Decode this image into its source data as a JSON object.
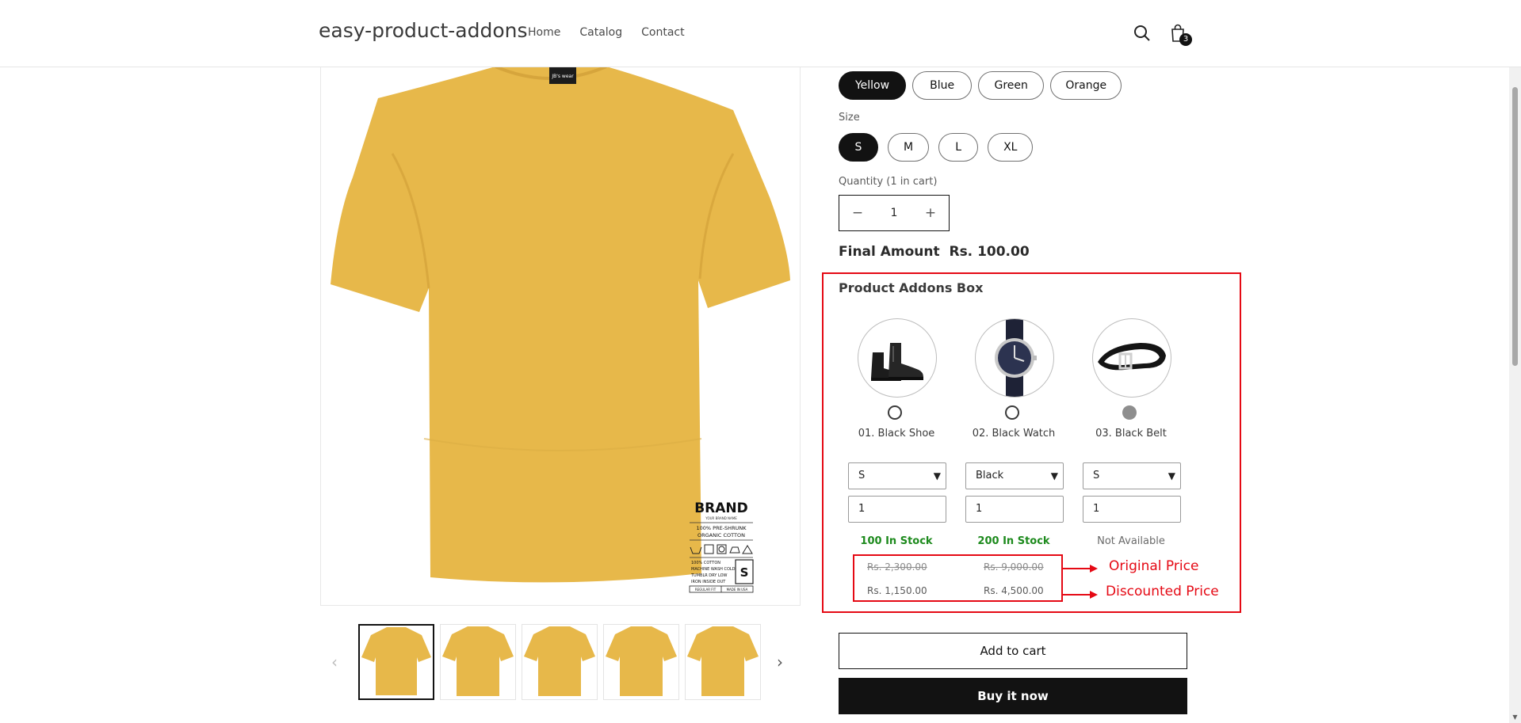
{
  "header": {
    "store_name": "easy-product-addons",
    "nav": [
      "Home",
      "Catalog",
      "Contact"
    ],
    "cart_count": "3"
  },
  "gallery": {
    "label_brand": "BRAND",
    "label_brand_sub": "YOUR BRAND NAME",
    "label_line1": "100% PRE-SHRUNK",
    "label_line2": "ORGANIC COTTON",
    "label_care1": "100% COTTON",
    "label_care2": "MACHINE WASH COLD",
    "label_care3": "TUMBLR DRY LOW",
    "label_care4": "IRON INSIDE OUT",
    "label_size": "S",
    "label_fit": "REGULAR FIT",
    "label_made": "MADE IN USA",
    "collar_tag": "JB's wear",
    "prev_arrow": "‹",
    "next_arrow": "›",
    "thumbnail_count": 5
  },
  "product": {
    "colors": [
      "Yellow",
      "Blue",
      "Green",
      "Orange"
    ],
    "selected_color": "Yellow",
    "size_label": "Size",
    "sizes": [
      "S",
      "M",
      "L",
      "XL"
    ],
    "selected_size": "S",
    "quantity_label": "Quantity (1 in cart)",
    "quantity_value": "1",
    "minus": "−",
    "plus": "+",
    "final_amount": "Final Amount  Rs. 100.00"
  },
  "addons": {
    "title": "Product Addons Box",
    "items": [
      {
        "name": "01. Black Shoe",
        "select": "S",
        "qty": "1",
        "stock": "100 In Stock",
        "original_price": "Rs. 2,300.00",
        "discounted_price": "Rs. 1,150.00"
      },
      {
        "name": "02. Black Watch",
        "select": "Black",
        "qty": "1",
        "stock": "200 In Stock",
        "original_price": "Rs. 9,000.00",
        "discounted_price": "Rs. 4,500.00"
      },
      {
        "name": "03. Black Belt",
        "select": "S",
        "qty": "1",
        "stock": "Not Available"
      }
    ],
    "annotation_original": "Original Price",
    "annotation_discounted": "Discounted Price"
  },
  "buttons": {
    "add_to_cart": "Add to cart",
    "buy_now": "Buy it now"
  },
  "colors": {
    "accent_red": "#e50914",
    "in_stock_green": "#1d8a1d",
    "shirt_yellow": "#e7b84a"
  }
}
